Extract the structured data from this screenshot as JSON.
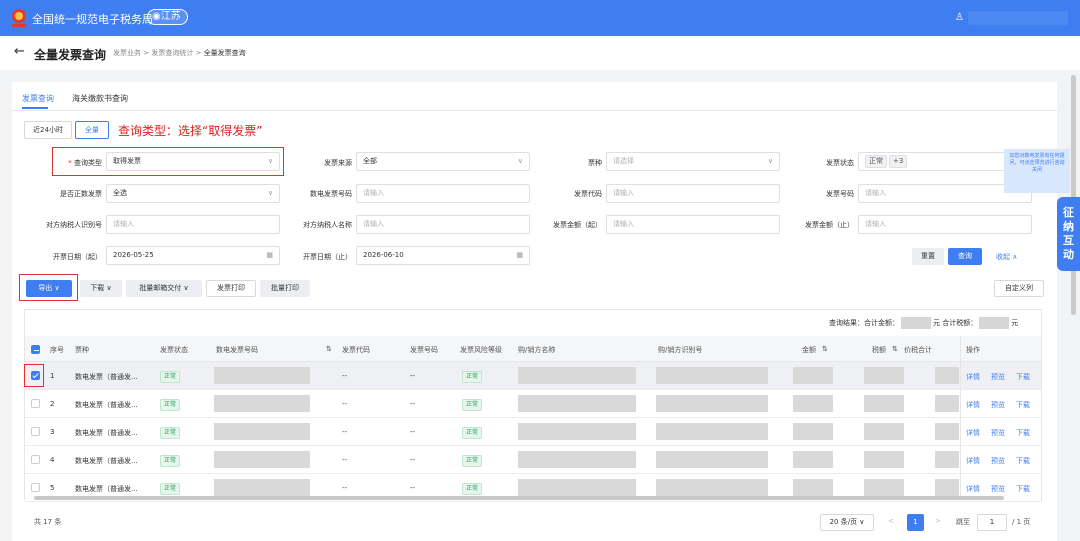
{
  "header": {
    "site_name": "全国统一规范电子税务局",
    "province": "江苏",
    "user_icon": "user-icon"
  },
  "breadcrumb": {
    "back": "←",
    "title": "全量发票查询",
    "trail": [
      "发票业务",
      "发票查询统计",
      "全量发票查询"
    ],
    "sep": ">"
  },
  "tabs": [
    "发票查询",
    "海关缴款书查询"
  ],
  "quick": {
    "h24": "近24小时",
    "all": "全量"
  },
  "annotation": "查询类型：选择“取得发票”",
  "filters": {
    "query_type": {
      "label": "查询类型",
      "value": "取得发票"
    },
    "source": {
      "label": "发票来源",
      "value": "全部"
    },
    "kind": {
      "label": "票种",
      "placeholder": "请选择"
    },
    "status": {
      "label": "发票状态",
      "tag": "正常",
      "more": "+3"
    },
    "positive": {
      "label": "是否正数发票",
      "value": "全选"
    },
    "digital_no": {
      "label": "数电发票号码",
      "placeholder": "请输入"
    },
    "code": {
      "label": "发票代码",
      "placeholder": "请输入"
    },
    "number": {
      "label": "发票号码",
      "placeholder": "请输入"
    },
    "taxid": {
      "label": "对方纳税人识别号",
      "placeholder": "请输入"
    },
    "taxname": {
      "label": "对方纳税人名称",
      "placeholder": "请输入"
    },
    "amt_from": {
      "label": "发票金额（起）",
      "placeholder": "请输入"
    },
    "amt_to": {
      "label": "发票金额（止）",
      "placeholder": "请输入"
    },
    "date_from": {
      "label": "开票日期（起）",
      "value": "2026-05-25"
    },
    "date_to": {
      "label": "开票日期（止）",
      "value": "2026-06-10"
    }
  },
  "actions": {
    "reset": "重置",
    "search": "查询",
    "collapse": "收起 ∧"
  },
  "help_text": "如您对数电发票有任何疑问，可点击预览进行咨询",
  "help_close": "关闭",
  "side_tab": "征纳互动",
  "toolbar": {
    "export": "导出 ∨",
    "download": "下载 ∨",
    "batch_mail": "批量邮箱交付 ∨",
    "print": "发票打印",
    "batch_print": "批量打印",
    "custom_cols": "自定义列"
  },
  "summary": {
    "result": "查询结果：合计金额：",
    "unit1": "元",
    "tax": "合计税额：",
    "unit2": "元"
  },
  "columns": [
    "序号",
    "票种",
    "发票状态",
    "数电发票号码",
    "发票代码",
    "发票号码",
    "发票风险等级",
    "购/销方名称",
    "购/销方识别号",
    "金额",
    "税额",
    "价税合计",
    "操作"
  ],
  "rows": [
    {
      "no": "1",
      "type": "数电发票（普通发...",
      "status": "正常",
      "code": "--",
      "number": "--",
      "risk": "正常"
    },
    {
      "no": "2",
      "type": "数电发票（普通发...",
      "status": "正常",
      "code": "--",
      "number": "--",
      "risk": "正常"
    },
    {
      "no": "3",
      "type": "数电发票（普通发...",
      "status": "正常",
      "code": "--",
      "number": "--",
      "risk": "正常"
    },
    {
      "no": "4",
      "type": "数电发票（普通发...",
      "status": "正常",
      "code": "--",
      "number": "--",
      "risk": "正常"
    },
    {
      "no": "5",
      "type": "数电发票（普通发...",
      "status": "正常",
      "code": "--",
      "number": "--",
      "risk": "正常"
    }
  ],
  "row_ops": [
    "详情",
    "预览",
    "下载"
  ],
  "footer": {
    "total": "共 17 条",
    "page_size": "20 条/页 ∨",
    "prev": "<",
    "page": "1",
    "next": ">",
    "goto": "跳至",
    "goto_val": "1",
    "pages": "/ 1 页"
  },
  "colors": {
    "brand": "#3f7ef0",
    "annotation": "#e02020",
    "ok": "#2aa15a"
  }
}
